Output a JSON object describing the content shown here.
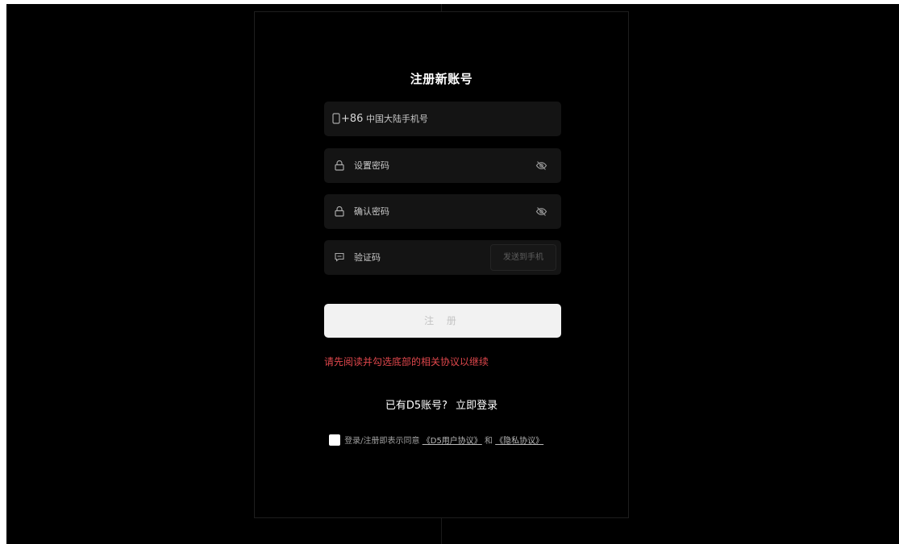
{
  "form": {
    "title": "注册新账号",
    "phone": {
      "prefix": "+86",
      "placeholder": "中国大陆手机号"
    },
    "password": {
      "placeholder": "设置密码"
    },
    "confirm_password": {
      "placeholder": "确认密码"
    },
    "code": {
      "placeholder": "验证码",
      "send_label": "发送到手机"
    },
    "submit_label": "注 册",
    "error_text": "请先阅读并勾选底部的相关协议以继续",
    "login_question": "已有D5账号?",
    "login_link": "立即登录",
    "agreement": {
      "text": "登录/注册即表示同意",
      "user_agreement": "《D5用户协议》",
      "and": "和",
      "privacy": "《隐私协议》"
    }
  },
  "colors": {
    "background": "#000000",
    "field": "#141414",
    "error": "#e0474c",
    "button_disabled": "#f2f2f2"
  },
  "icons": {
    "phone": "phone-icon",
    "lock": "lock-icon",
    "eye_off": "eye-off-icon",
    "message": "message-icon"
  }
}
